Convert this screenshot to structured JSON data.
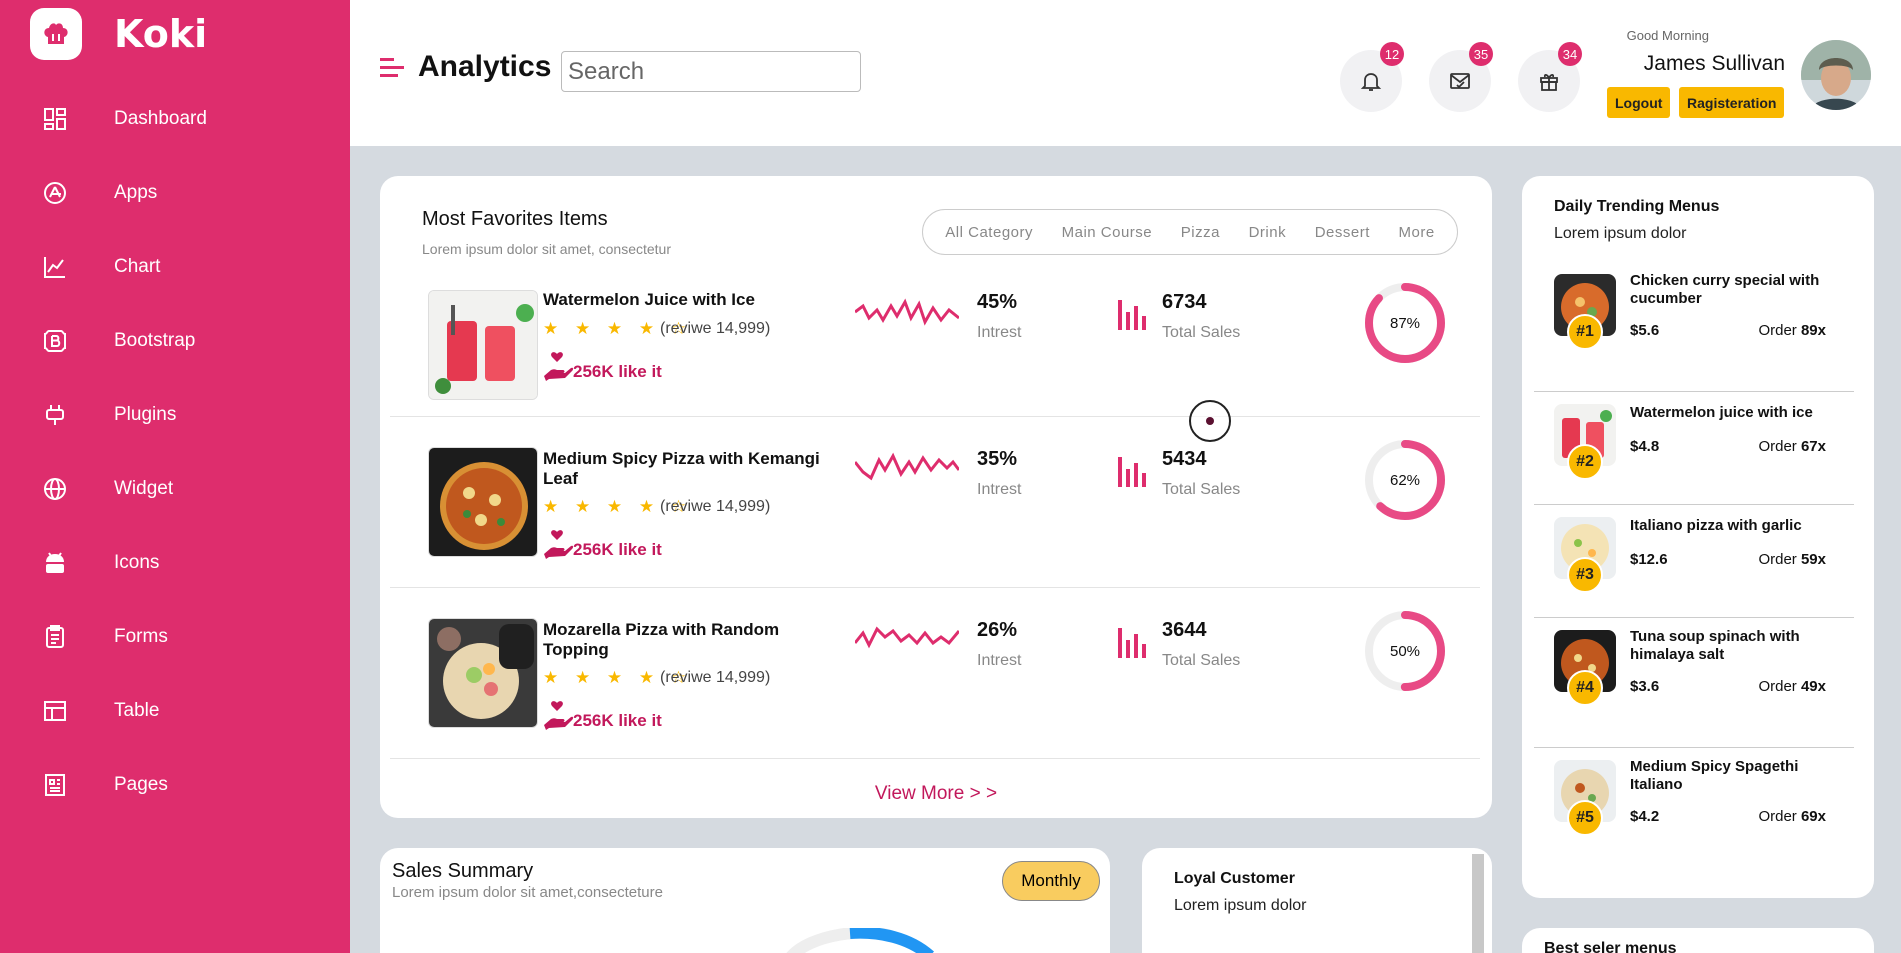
{
  "brand": {
    "name": "Koki"
  },
  "sidebar": {
    "items": [
      {
        "label": "Dashboard",
        "icon": "dashboard-icon"
      },
      {
        "label": "Apps",
        "icon": "apps-icon"
      },
      {
        "label": "Chart",
        "icon": "chart-icon"
      },
      {
        "label": "Bootstrap",
        "icon": "bootstrap-icon"
      },
      {
        "label": "Plugins",
        "icon": "plugins-icon"
      },
      {
        "label": "Widget",
        "icon": "widget-icon"
      },
      {
        "label": "Icons",
        "icon": "icons-icon"
      },
      {
        "label": "Forms",
        "icon": "forms-icon"
      },
      {
        "label": "Table",
        "icon": "table-icon"
      },
      {
        "label": "Pages",
        "icon": "pages-icon"
      }
    ]
  },
  "header": {
    "title": "Analytics",
    "search_placeholder": "Search",
    "notifications": {
      "count": "12"
    },
    "messages": {
      "count": "35"
    },
    "gifts": {
      "count": "34"
    },
    "greeting": "Good Morning",
    "user": "James Sullivan",
    "logout": "Logout",
    "register": "Ragisteration"
  },
  "favorites": {
    "title": "Most Favorites Items",
    "subtitle": "Lorem ipsum dolor sit amet, consectetur",
    "categories": [
      "All Category",
      "Main Course",
      "Pizza",
      "Drink",
      "Dessert",
      "More"
    ],
    "items": [
      {
        "name": "Watermelon Juice with Ice",
        "stars": "★ ★ ★ ★ ☆",
        "rating": 3.5,
        "review": "(reviwe 14,999)",
        "likes": "256K like it",
        "interest": "45%",
        "interest_label": "Intrest",
        "sales": "6734",
        "sales_label": "Total Sales",
        "progress": "87%",
        "progress_value": 87
      },
      {
        "name": "Medium Spicy Pizza with Kemangi Leaf",
        "stars": "★ ★ ★ ★ ☆",
        "rating": 3.5,
        "review": "(reviwe 14,999)",
        "likes": "256K like it",
        "interest": "35%",
        "interest_label": "Intrest",
        "sales": "5434",
        "sales_label": "Total Sales",
        "progress": "62%",
        "progress_value": 62
      },
      {
        "name": "Mozarella Pizza with Random Topping",
        "stars": "★ ★ ★ ★ ☆",
        "rating": 3.5,
        "review": "(reviwe 14,999)",
        "likes": "256K like it",
        "interest": "26%",
        "interest_label": "Intrest",
        "sales": "3644",
        "sales_label": "Total Sales",
        "progress": "50%",
        "progress_value": 50
      }
    ],
    "view_more": "View More > >"
  },
  "trending": {
    "title": "Daily Trending Menus",
    "subtitle": "Lorem ipsum dolor",
    "items": [
      {
        "rank": "#1",
        "name": "Chicken curry special with cucumber",
        "price": "$5.6",
        "order_label": "Order",
        "order": "89x"
      },
      {
        "rank": "#2",
        "name": "Watermelon juice with ice",
        "price": "$4.8",
        "order_label": "Order",
        "order": "67x"
      },
      {
        "rank": "#3",
        "name": "Italiano pizza with garlic",
        "price": "$12.6",
        "order_label": "Order",
        "order": "59x"
      },
      {
        "rank": "#4",
        "name": "Tuna soup spinach with himalaya salt",
        "price": "$3.6",
        "order_label": "Order",
        "order": "49x"
      },
      {
        "rank": "#5",
        "name": "Medium Spicy Spagethi Italiano",
        "price": "$4.2",
        "order_label": "Order",
        "order": "69x"
      }
    ]
  },
  "summary": {
    "title": "Sales Summary",
    "subtitle": "Lorem ipsum dolor sit amet,consecteture",
    "period": "Monthly"
  },
  "loyal": {
    "title": "Loyal Customer",
    "subtitle": "Lorem ipsum dolor"
  },
  "best": {
    "title": "Best seler menus"
  },
  "colors": {
    "brand": "#de2d6d",
    "accent": "#f9b800",
    "background": "#d5dae0"
  }
}
